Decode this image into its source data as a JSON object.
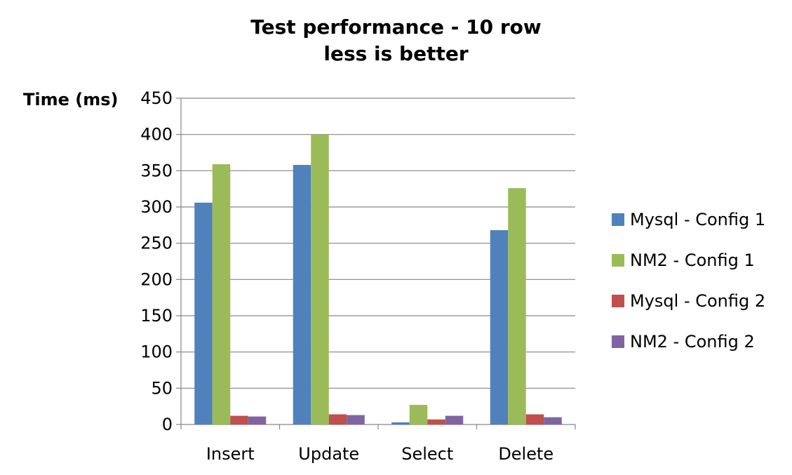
{
  "chart_data": {
    "type": "bar",
    "title_lines": [
      "Test performance - 10 row",
      "less is better"
    ],
    "ylabel": "Time (ms)",
    "xlabel": "",
    "ylim": [
      0,
      450
    ],
    "yticks": [
      0,
      50,
      100,
      150,
      200,
      250,
      300,
      350,
      400,
      450
    ],
    "grid": true,
    "legend_position": "right",
    "categories": [
      "Insert",
      "Update",
      "Select",
      "Delete"
    ],
    "series": [
      {
        "name": "Mysql - Config 1",
        "color": "#4F81BD",
        "values": [
          306,
          358,
          3,
          268
        ]
      },
      {
        "name": "NM2 - Config 1",
        "color": "#9BBB59",
        "values": [
          359,
          400,
          27,
          326
        ]
      },
      {
        "name": "Mysql - Config 2",
        "color": "#C0504D",
        "values": [
          12,
          14,
          7,
          14
        ]
      },
      {
        "name": "NM2 - Config 2",
        "color": "#8064A2",
        "values": [
          11,
          13,
          12,
          10
        ]
      }
    ]
  }
}
